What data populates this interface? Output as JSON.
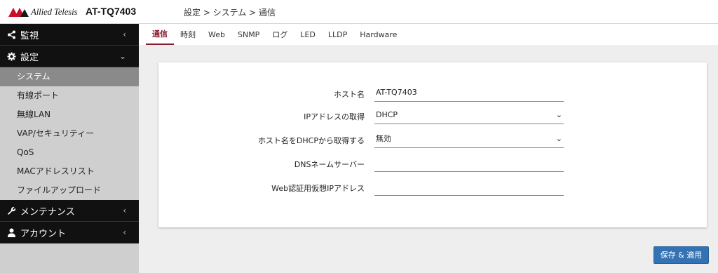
{
  "header": {
    "logo_text": "Allied Telesis",
    "model": "AT-TQ7403",
    "breadcrumb": "設定 > システム > 通信"
  },
  "sidebar": {
    "groups": [
      {
        "label": "監視",
        "icon": "share-icon",
        "expanded": false
      },
      {
        "label": "設定",
        "icon": "gear-icon",
        "expanded": true,
        "items": [
          {
            "label": "システム",
            "active": true
          },
          {
            "label": "有線ポート"
          },
          {
            "label": "無線LAN"
          },
          {
            "label": "VAP/セキュリティー"
          },
          {
            "label": "QoS"
          },
          {
            "label": "MACアドレスリスト"
          },
          {
            "label": "ファイルアップロード"
          }
        ]
      },
      {
        "label": "メンテナンス",
        "icon": "wrench-icon",
        "expanded": false
      },
      {
        "label": "アカウント",
        "icon": "user-icon",
        "expanded": false
      }
    ]
  },
  "tabs": [
    "通信",
    "時刻",
    "Web",
    "SNMP",
    "ログ",
    "LED",
    "LLDP",
    "Hardware"
  ],
  "active_tab": "通信",
  "form": {
    "hostname": {
      "label": "ホスト名",
      "value": "AT-TQ7403"
    },
    "ip_acquire": {
      "label": "IPアドレスの取得",
      "value": "DHCP"
    },
    "hostname_dhcp": {
      "label": "ホスト名をDHCPから取得する",
      "value": "無効"
    },
    "dns": {
      "label": "DNSネームサーバー",
      "value": ""
    },
    "web_auth_ip": {
      "label": "Web認証用仮想IPアドレス",
      "value": ""
    }
  },
  "apply_button": "保存 & 適用",
  "colors": {
    "accent": "#8b1a2b",
    "button": "#3372b4",
    "sidebar_dark": "#111111",
    "sidebar_light": "#cfcfcf",
    "sidebar_active": "#8a8a8a",
    "logo_red": "#c8102e"
  }
}
